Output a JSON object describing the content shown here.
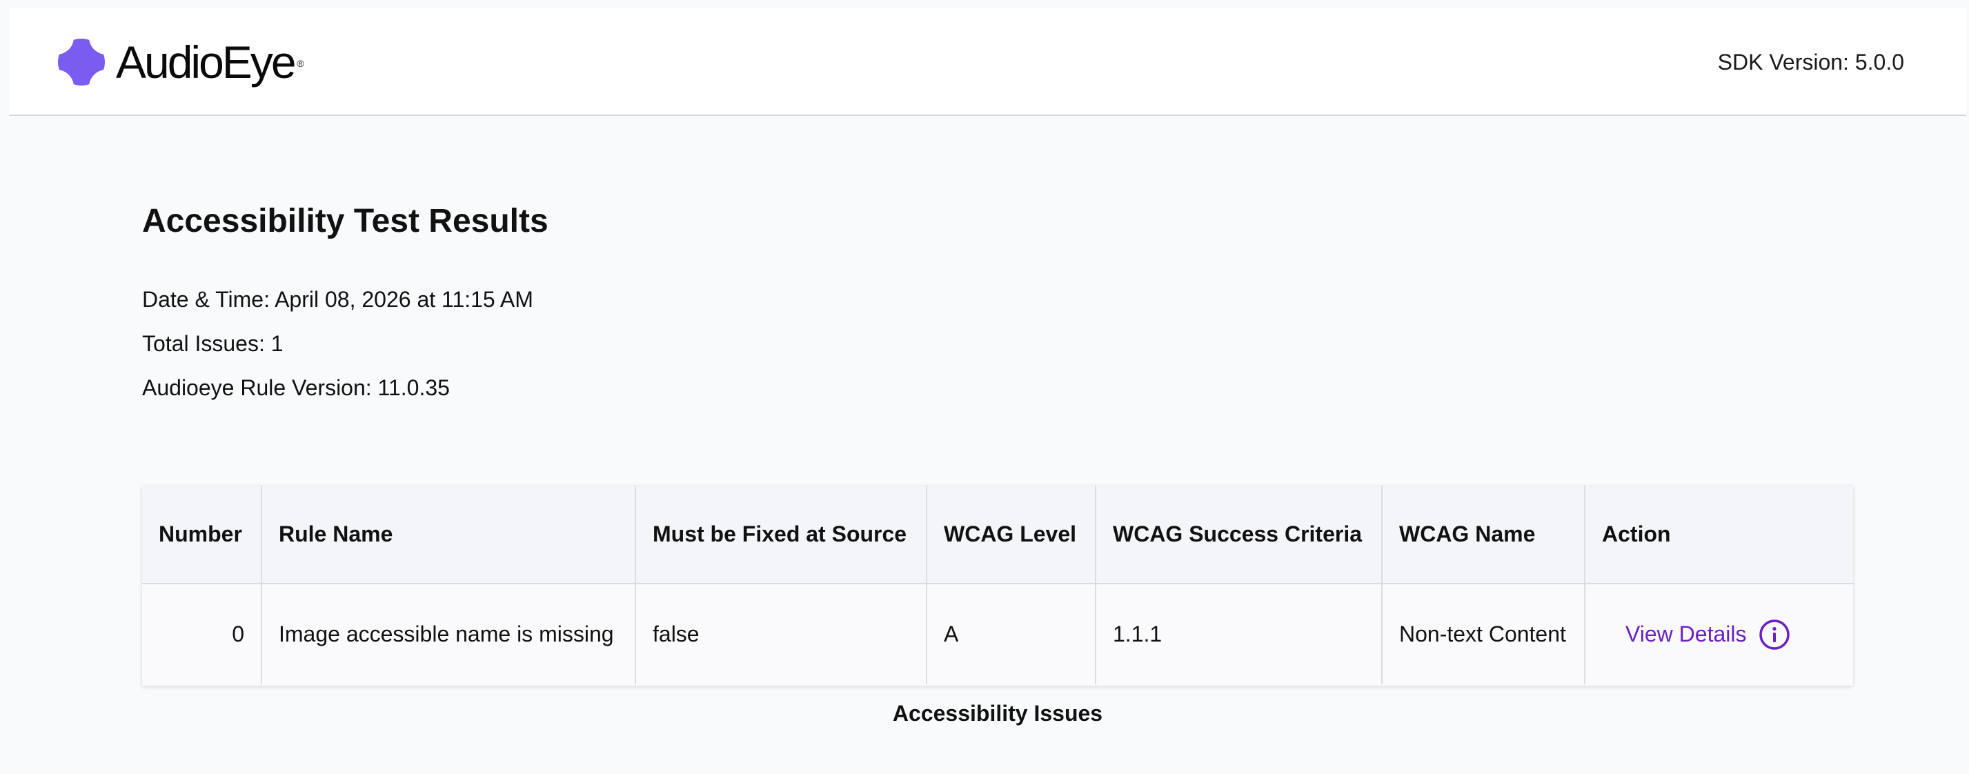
{
  "header": {
    "logo_text": "AudioEye",
    "logo_registered": "®",
    "sdk_version": "SDK Version: 5.0.0"
  },
  "colors": {
    "accent": "#6a1fc7",
    "logo_icon": "#7b5cf0",
    "background": "#f9fafc",
    "header_background": "#ffffff"
  },
  "report": {
    "title": "Accessibility Test Results",
    "date_time": "Date & Time: April 08, 2026 at 11:15 AM",
    "total_issues": "Total Issues: 1",
    "rule_version": "Audioeye Rule Version: 11.0.35"
  },
  "table": {
    "columns": [
      "Number",
      "Rule Name",
      "Must be Fixed at Source",
      "WCAG Level",
      "WCAG Success Criteria",
      "WCAG Name",
      "Action"
    ],
    "rows": [
      {
        "number": "0",
        "rule_name": "Image accessible name is missing",
        "must_fix_at_source": "false",
        "wcag_level": "A",
        "wcag_success_criteria": "1.1.1",
        "wcag_name": "Non-text Content",
        "action_label": "View Details",
        "action_icon": "info-circle-icon"
      }
    ],
    "caption": "Accessibility Issues"
  }
}
